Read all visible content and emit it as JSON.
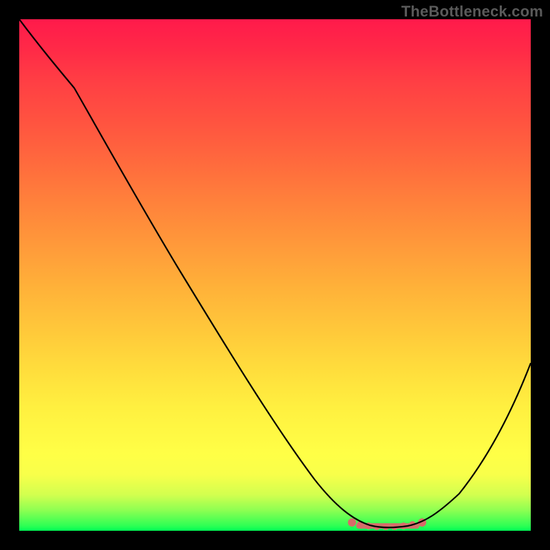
{
  "watermark": "TheBottleneck.com",
  "chart_data": {
    "type": "line",
    "title": "",
    "xlabel": "",
    "ylabel": "",
    "xlim": [
      0,
      100
    ],
    "ylim": [
      0,
      100
    ],
    "x": [
      0,
      5,
      10,
      15,
      20,
      25,
      30,
      35,
      40,
      45,
      50,
      55,
      60,
      63,
      65,
      67,
      69,
      71,
      73,
      75,
      77,
      79,
      81,
      85,
      90,
      95,
      100
    ],
    "values": [
      100,
      96,
      90,
      82,
      74,
      66,
      58,
      49,
      41,
      33,
      25,
      17,
      10,
      6,
      4,
      2.5,
      1.5,
      1,
      0.8,
      0.8,
      0.9,
      1.3,
      2.2,
      6,
      13,
      23,
      35
    ],
    "optimum_band": {
      "x_start": 65,
      "x_end": 80,
      "approx_y": 1
    },
    "gradient_semantics": "red(top)=bad, green(bottom)=good"
  },
  "colors": {
    "curve": "#000000",
    "band_marker": "#d86a6a",
    "background_frame": "#000000"
  }
}
